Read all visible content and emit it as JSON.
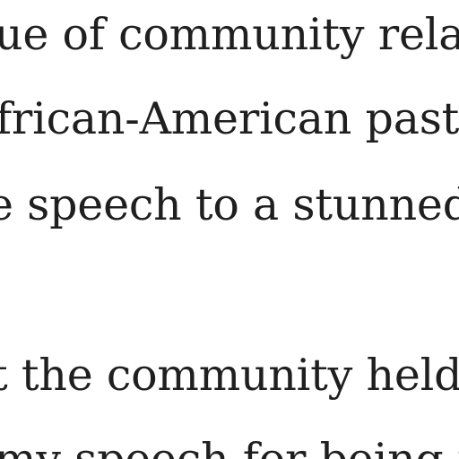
{
  "article": {
    "paragraph_1": {
      "lines": [
        "ue of community rela",
        "frican-American past",
        "e speech to a stunned"
      ]
    },
    "paragraph_2": {
      "lines": [
        "t the community held",
        "my speech for being i"
      ]
    }
  }
}
